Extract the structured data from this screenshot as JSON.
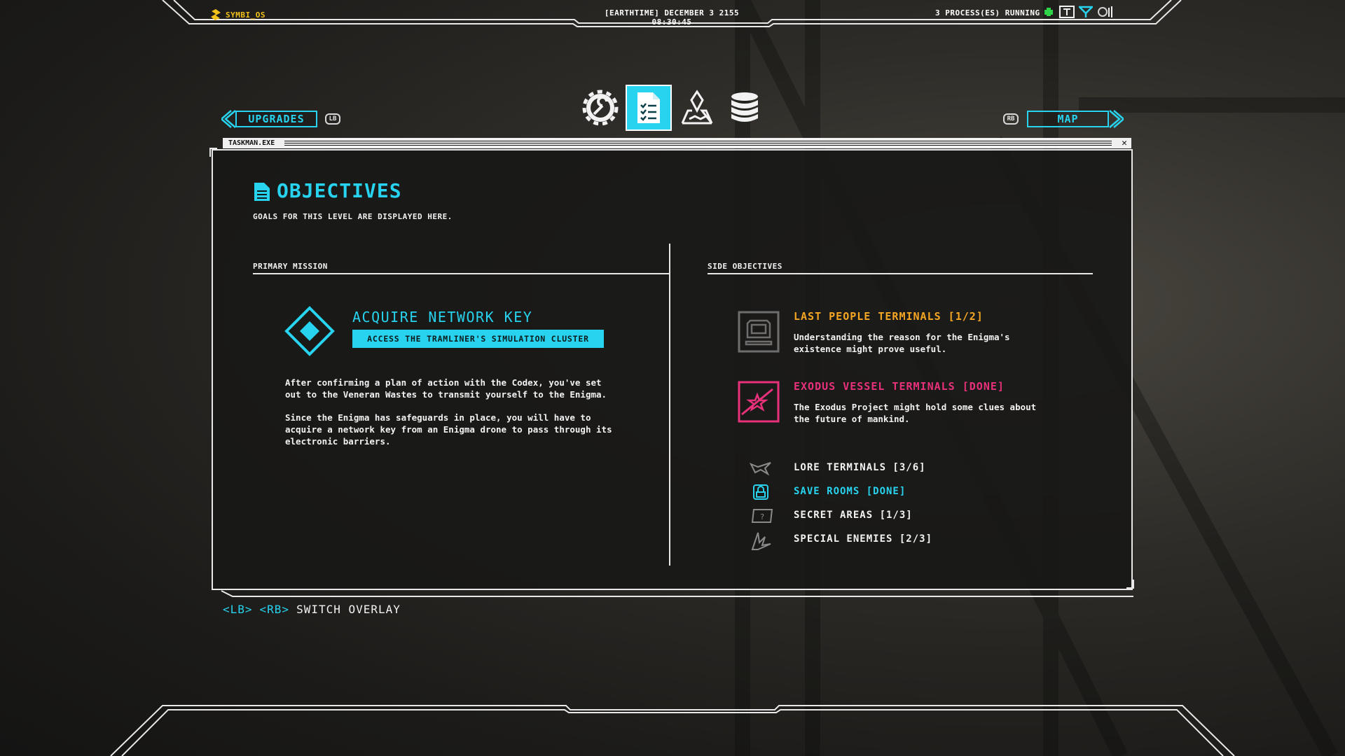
{
  "topbar": {
    "os_name": "SYMBI_OS",
    "datetime": "[EARTHTIME] DECEMBER 3 2155 08:30:45",
    "processes": "3 PROCESS(ES) RUNNING"
  },
  "nav": {
    "left_button": "UPGRADES",
    "left_badge": "LB",
    "right_button": "MAP",
    "right_badge": "RB",
    "tabs": [
      {
        "icon": "gear-wrench-icon",
        "active": false
      },
      {
        "icon": "document-checklist-icon",
        "active": true
      },
      {
        "icon": "map-marker-icon",
        "active": false
      },
      {
        "icon": "database-icon",
        "active": false
      }
    ]
  },
  "window": {
    "title": "TASKMAN.EXE",
    "close": "✕"
  },
  "objectives": {
    "title": "OBJECTIVES",
    "subtitle": "GOALS FOR THIS LEVEL ARE DISPLAYED HERE.",
    "primary_header": "PRIMARY MISSION",
    "side_header": "SIDE OBJECTIVES",
    "primary": {
      "title": "ACQUIRE NETWORK KEY",
      "subtitle": "ACCESS THE TRAMLINER'S SIMULATION CLUSTER",
      "paragraph1_line1": "After confirming a plan of action with the Codex, you've set",
      "paragraph1_line2": "out to the Veneran Wastes to transmit yourself to the Enigma.",
      "paragraph2_line1": "Since the Enigma has safeguards in place, you will have to",
      "paragraph2_line2": "acquire a network key from an Enigma drone to pass through its",
      "paragraph2_line3": "electronic barriers."
    },
    "side": [
      {
        "title": "LAST PEOPLE TERMINALS [1/2]",
        "desc_line1": "Understanding the reason for the Enigma's",
        "desc_line2": "existence might prove useful.",
        "color": "#f5a623",
        "icon": "terminal-icon"
      },
      {
        "title": "EXODUS VESSEL TERMINALS [DONE]",
        "desc_line1": "The Exodus Project might hold some clues about",
        "desc_line2": "the future of mankind.",
        "color": "#e8317a",
        "icon": "star-flag-icon"
      }
    ],
    "counters": [
      {
        "label": "LORE TERMINALS [3/6]",
        "icon": "ship-icon",
        "color": "#f2f2f2"
      },
      {
        "label": "SAVE ROOMS [DONE]",
        "icon": "save-room-icon",
        "color": "#27d3ee"
      },
      {
        "label": "SECRET AREAS [1/3]",
        "icon": "secret-icon",
        "color": "#f2f2f2"
      },
      {
        "label": "SPECIAL ENEMIES [2/3]",
        "icon": "enemy-icon",
        "color": "#f2f2f2"
      }
    ]
  },
  "footer": {
    "lb": "<LB>",
    "rb": "<RB>",
    "label": "SWITCH OVERLAY"
  },
  "colors": {
    "accent": "#27d3ee",
    "os_yellow": "#f2c21a",
    "orange": "#f5a623",
    "pink": "#e8317a"
  }
}
